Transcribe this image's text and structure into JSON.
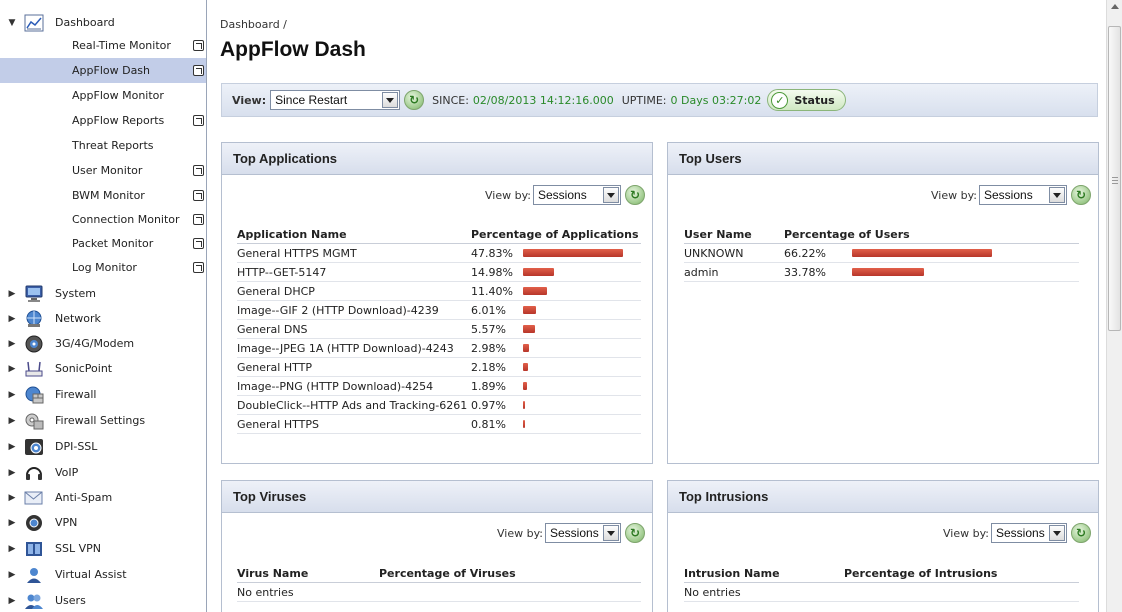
{
  "sidebar": {
    "dashboard": {
      "label": "Dashboard",
      "icon": "chart-icon"
    },
    "subitems": [
      {
        "label": "Real-Time Monitor",
        "ext": true
      },
      {
        "label": "AppFlow Dash",
        "ext": true,
        "active": true
      },
      {
        "label": "AppFlow Monitor",
        "ext": false
      },
      {
        "label": "AppFlow Reports",
        "ext": true
      },
      {
        "label": "Threat Reports",
        "ext": false
      },
      {
        "label": "User Monitor",
        "ext": true
      },
      {
        "label": "BWM Monitor",
        "ext": true
      },
      {
        "label": "Connection Monitor",
        "ext": true
      },
      {
        "label": "Packet Monitor",
        "ext": true
      },
      {
        "label": "Log Monitor",
        "ext": true
      }
    ],
    "sections": [
      {
        "label": "System",
        "icon": "monitor-icon"
      },
      {
        "label": "Network",
        "icon": "globe-network-icon"
      },
      {
        "label": "3G/4G/Modem",
        "icon": "modem-icon"
      },
      {
        "label": "SonicPoint",
        "icon": "access-point-icon"
      },
      {
        "label": "Firewall",
        "icon": "firewall-icon"
      },
      {
        "label": "Firewall Settings",
        "icon": "firewall-settings-icon"
      },
      {
        "label": "DPI-SSL",
        "icon": "dpi-ssl-icon"
      },
      {
        "label": "VoIP",
        "icon": "headset-icon"
      },
      {
        "label": "Anti-Spam",
        "icon": "envelope-icon"
      },
      {
        "label": "VPN",
        "icon": "vpn-icon"
      },
      {
        "label": "SSL VPN",
        "icon": "ssl-vpn-icon"
      },
      {
        "label": "Virtual Assist",
        "icon": "virtual-assist-icon"
      },
      {
        "label": "Users",
        "icon": "users-icon"
      }
    ]
  },
  "breadcrumb": "Dashboard /",
  "title": "AppFlow Dash",
  "viewbar": {
    "view_label": "View:",
    "view_value": "Since Restart",
    "since_label": "SINCE:",
    "since_value": "02/08/2013 14:12:16.000",
    "uptime_label": "UPTIME:",
    "uptime_value": "0 Days 03:27:02",
    "status_label": "Status"
  },
  "panels": {
    "apps": {
      "title": "Top Applications",
      "viewby_label": "View by:",
      "viewby_value": "Sessions",
      "col1": "Application Name",
      "col2": "Percentage of Applications",
      "rows": [
        {
          "name": "General HTTPS MGMT",
          "pct": "47.83%",
          "value": 47.83
        },
        {
          "name": "HTTP--GET-5147",
          "pct": "14.98%",
          "value": 14.98
        },
        {
          "name": "General DHCP",
          "pct": "11.40%",
          "value": 11.4
        },
        {
          "name": "Image--GIF 2 (HTTP Download)-4239",
          "pct": "6.01%",
          "value": 6.01
        },
        {
          "name": "General DNS",
          "pct": "5.57%",
          "value": 5.57
        },
        {
          "name": "Image--JPEG 1A (HTTP Download)-4243",
          "pct": "2.98%",
          "value": 2.98
        },
        {
          "name": "General HTTP",
          "pct": "2.18%",
          "value": 2.18
        },
        {
          "name": "Image--PNG (HTTP Download)-4254",
          "pct": "1.89%",
          "value": 1.89
        },
        {
          "name": "DoubleClick--HTTP Ads and Tracking-6261",
          "pct": "0.97%",
          "value": 0.97
        },
        {
          "name": "General HTTPS",
          "pct": "0.81%",
          "value": 0.81
        }
      ]
    },
    "users": {
      "title": "Top Users",
      "viewby_label": "View by:",
      "viewby_value": "Sessions",
      "col1": "User Name",
      "col2": "Percentage of Users",
      "rows": [
        {
          "name": "UNKNOWN",
          "pct": "66.22%",
          "value": 66.22
        },
        {
          "name": "admin",
          "pct": "33.78%",
          "value": 33.78
        }
      ]
    },
    "viruses": {
      "title": "Top Viruses",
      "viewby_label": "View by:",
      "viewby_value": "Sessions",
      "col1": "Virus Name",
      "col2": "Percentage of Viruses",
      "empty": "No entries"
    },
    "intrusions": {
      "title": "Top Intrusions",
      "viewby_label": "View by:",
      "viewby_value": "Sessions",
      "col1": "Intrusion Name",
      "col2": "Percentage of Intrusions",
      "empty": "No entries"
    }
  },
  "colors": {
    "bar": "#c94535",
    "active_nav": "#c2cde8",
    "green_text": "#2a8a2a"
  }
}
